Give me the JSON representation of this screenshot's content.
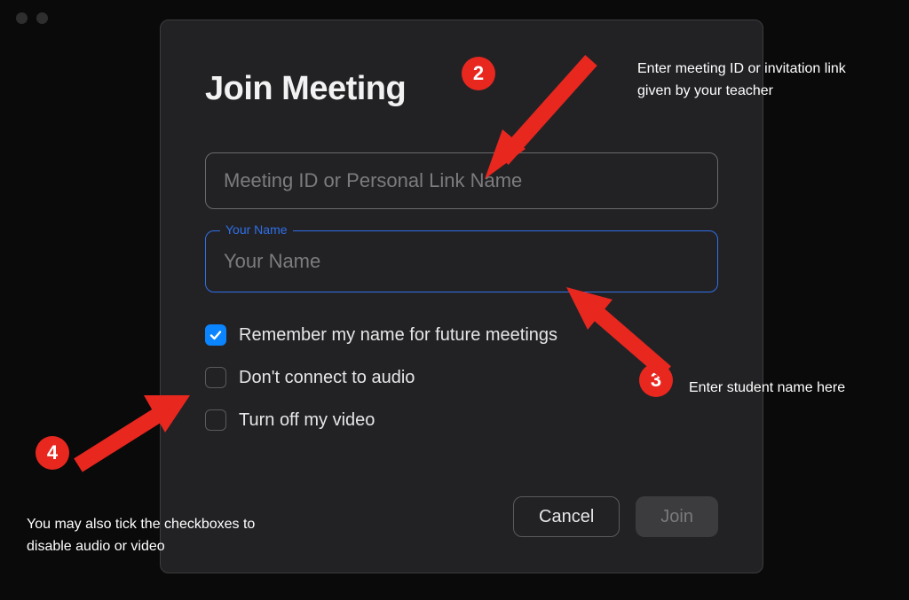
{
  "dialog": {
    "title": "Join Meeting",
    "meeting_id": {
      "placeholder": "Meeting ID or Personal Link Name",
      "value": ""
    },
    "name_field": {
      "label": "Your Name",
      "placeholder": "Your Name",
      "value": ""
    },
    "checkboxes": {
      "remember": {
        "label": "Remember my name for future meetings",
        "checked": true
      },
      "no_audio": {
        "label": "Don't connect to audio",
        "checked": false
      },
      "no_video": {
        "label": "Turn off my video",
        "checked": false
      }
    },
    "buttons": {
      "cancel": "Cancel",
      "join": "Join"
    }
  },
  "annotations": {
    "step2": {
      "num": "2",
      "text": "Enter meeting ID  or invitation link given by your teacher"
    },
    "step3": {
      "num": "3",
      "text": "Enter student name here"
    },
    "step4": {
      "num": "4",
      "text": "You may also tick the checkboxes to disable audio or video"
    }
  },
  "colors": {
    "accent": "#0a84ff",
    "annot": "#e8271f",
    "focus": "#2f6fe8"
  }
}
